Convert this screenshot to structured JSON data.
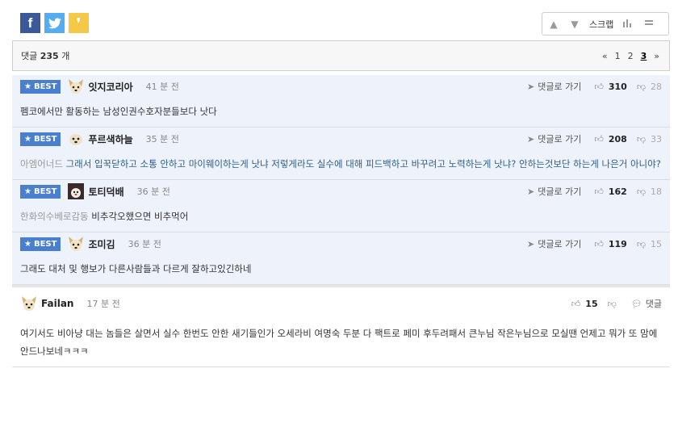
{
  "share": {
    "facebook": "f",
    "twitter": "t",
    "kakao": "❜"
  },
  "toolbar": {
    "scrap_label": "스크랩",
    "up": "▲",
    "down": "▼"
  },
  "comment_bar": {
    "label": "댓글",
    "count": "235",
    "unit": "개",
    "pages": [
      "«",
      "1",
      "2",
      "3",
      "»"
    ],
    "current_page": "3"
  },
  "comments": [
    {
      "best": true,
      "badge": "BEST",
      "nick": "잇지코리아",
      "time": "41 분 전",
      "reply": "댓글로 가기",
      "up": "310",
      "down": "28",
      "quote": "",
      "text": "펨코에서만 활동하는 남성인권수호자분들보다 낫다"
    },
    {
      "best": true,
      "badge": "BEST",
      "nick": "푸르색하늘",
      "time": "35 분 전",
      "reply": "댓글로 가기",
      "up": "208",
      "down": "33",
      "quote": "아엠어너드",
      "text": "그래서 입꾹닫하고 소통 안하고 마이웨이하는게 낫냐 저렇게라도 실수에 대해 피드백하고 바꾸려고 노력하는게 낫냐? 안하는것보단 하는게 나은거 아니야?"
    },
    {
      "best": true,
      "badge": "BEST",
      "nick": "토티덕배",
      "time": "36 분 전",
      "reply": "댓글로 가기",
      "up": "162",
      "down": "18",
      "quote": "한화의수베로감동",
      "text": "비추각오했으면 비추먹어"
    },
    {
      "best": true,
      "badge": "BEST",
      "nick": "조미김",
      "time": "36 분 전",
      "reply": "댓글로 가기",
      "up": "119",
      "down": "15",
      "quote": "",
      "text": "그래도 대처 및 행보가 다른사람들과 다르게 잘하고있긴하네"
    },
    {
      "best": false,
      "badge": "",
      "nick": "Failan",
      "time": "17 분 전",
      "reply": "댓글",
      "up": "15",
      "down": "",
      "quote": "",
      "text": "여기서도 비아냥 대는 놈들은 살면서 실수 한번도 안한 새기들인가 오세라비 여명숙 두분 다 팩트로 페미 후두려패서 큰누님 작은누님으로 모실땐 언제고 뭐가 또 맘에 안드나보네ㅋㅋㅋ"
    }
  ]
}
